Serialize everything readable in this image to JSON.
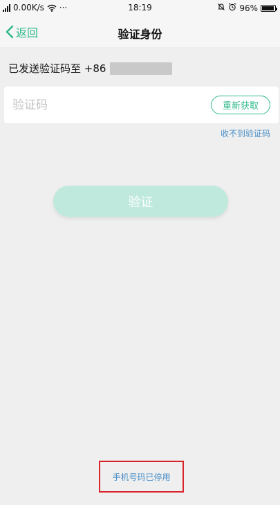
{
  "status_bar": {
    "speed": "0.00K/s",
    "dots": "···",
    "time": "18:19",
    "battery": "96%",
    "battery_level": 0.96
  },
  "nav": {
    "back_label": "返回",
    "title": "验证身份"
  },
  "sent_info": {
    "text": "已发送验证码至 +86"
  },
  "code": {
    "placeholder": "验证码",
    "value": "",
    "resend_label": "重新获取"
  },
  "not_received_label": "收不到验证码",
  "verify_label": "验证",
  "phone_stopped_label": "手机号码已停用",
  "colors": {
    "accent": "#33b98f",
    "link": "#4a90c8",
    "highlight_box": "#d9232b"
  }
}
